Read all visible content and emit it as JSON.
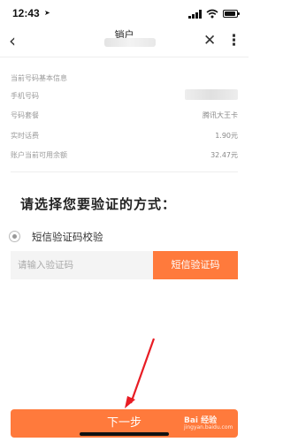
{
  "status_bar": {
    "time": "12:43"
  },
  "nav": {
    "title": "销户"
  },
  "info": {
    "rows": [
      {
        "label": "当前号码基本信息",
        "value": ""
      },
      {
        "label": "手机号码",
        "value": ""
      },
      {
        "label": "号码套餐",
        "value": "腾讯大王卡"
      },
      {
        "label": "实时话费",
        "value": "1.90元"
      },
      {
        "label": "账户当前可用余额",
        "value": "32.47元"
      }
    ]
  },
  "verify": {
    "heading": "请选择您要验证的方式：",
    "option_label": "短信验证码校验",
    "input_placeholder": "请输入验证码",
    "sms_button": "短信验证码"
  },
  "footer": {
    "next_button": "下一步"
  },
  "watermark": {
    "logo": "Bai 经验",
    "sub": "jingyan.baidu.com"
  },
  "colors": {
    "accent": "#ff7a3c",
    "annotation_arrow": "#e81c24"
  }
}
